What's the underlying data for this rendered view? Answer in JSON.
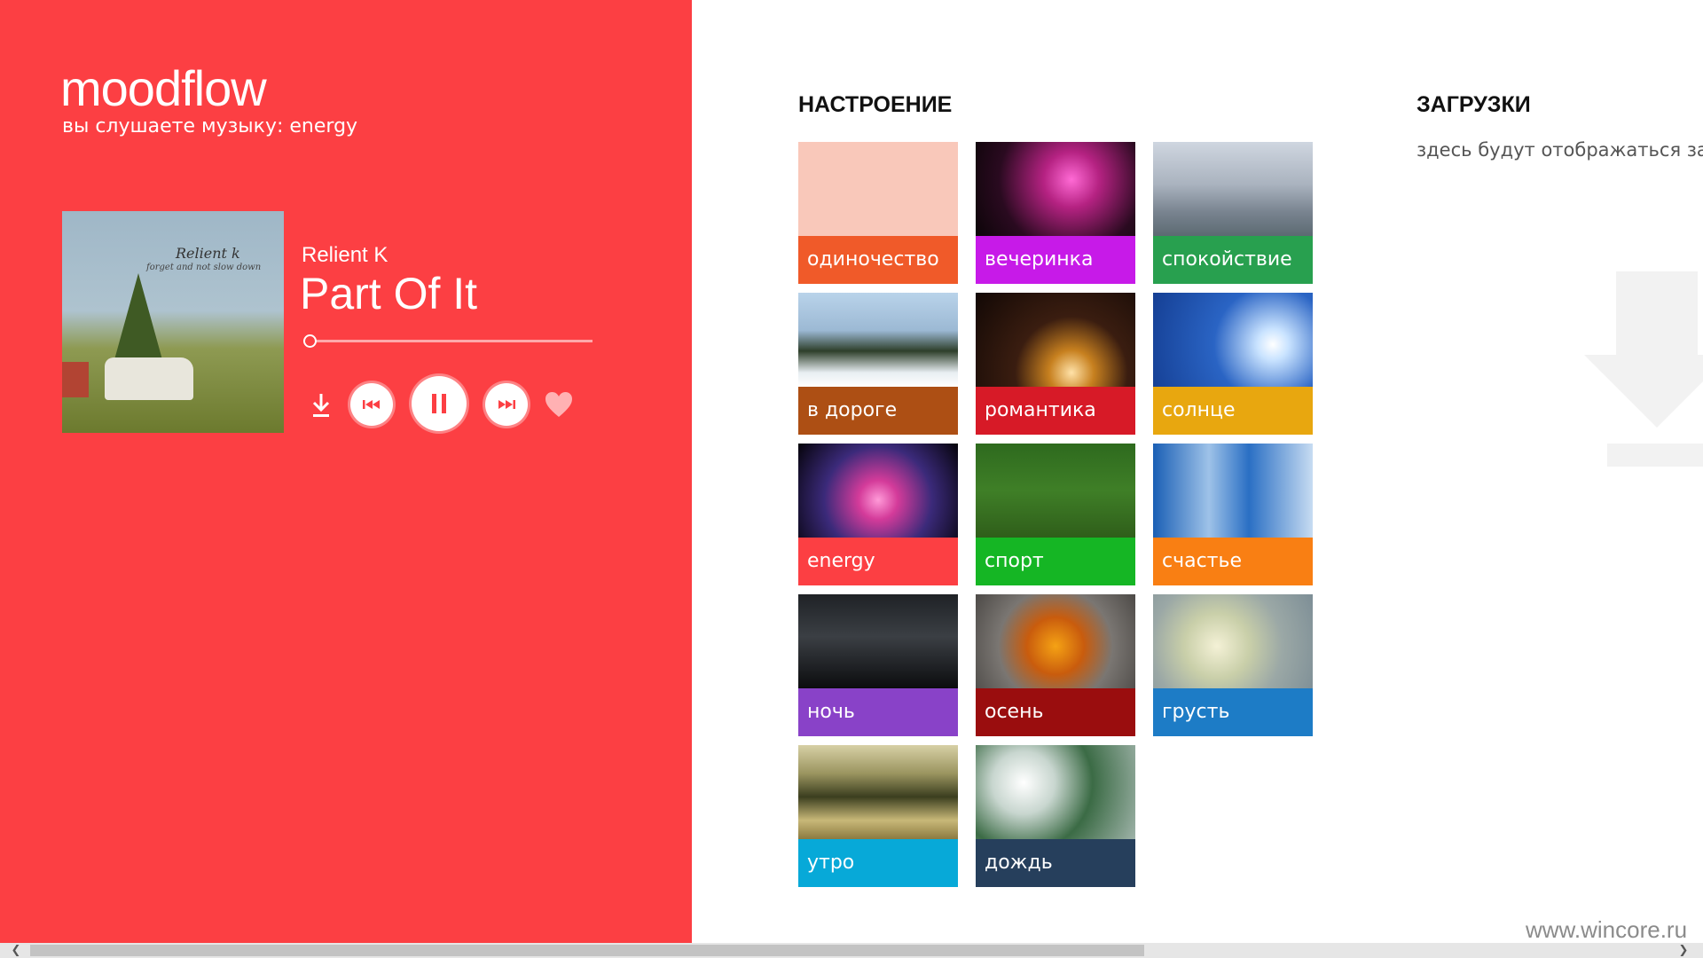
{
  "app": {
    "logo": "moodflow",
    "now_playing_caption": "вы слушаете музыку: energy"
  },
  "player": {
    "artist": "Relient K",
    "title": "Part Of It",
    "cover_text": [
      "Relient k",
      "forget and not slow down"
    ],
    "progress_fraction": 0.02,
    "controls": [
      "download-icon",
      "previous-icon",
      "pause-icon",
      "next-icon",
      "heart-icon"
    ]
  },
  "colors": {
    "accent": "#fc3f43",
    "background": "#ffffff"
  },
  "moods": {
    "heading": "НАСТРОЕНИЕ",
    "tiles": [
      {
        "label": "одиночество",
        "color": "#f05a29",
        "photo": "peach"
      },
      {
        "label": "вечеринка",
        "color": "#c71ae8",
        "photo": "fireworks"
      },
      {
        "label": "спокойствие",
        "color": "#28a04f",
        "photo": "clouds"
      },
      {
        "label": "в дороге",
        "color": "#ad4f14",
        "photo": "mountain"
      },
      {
        "label": "романтика",
        "color": "#d71a27",
        "photo": "candle"
      },
      {
        "label": "солнце",
        "color": "#e8a70f",
        "photo": "sky"
      },
      {
        "label": "energy",
        "color": "#fc3f43",
        "photo": "plasma"
      },
      {
        "label": "спорт",
        "color": "#15b624",
        "photo": "grass"
      },
      {
        "label": "счастье",
        "color": "#f97f13",
        "photo": "sign"
      },
      {
        "label": "ночь",
        "color": "#8942c8",
        "photo": "city"
      },
      {
        "label": "осень",
        "color": "#9a0d0e",
        "photo": "leaf"
      },
      {
        "label": "грусть",
        "color": "#1d7cc6",
        "photo": "flower"
      },
      {
        "label": "утро",
        "color": "#07a9d8",
        "photo": "lake"
      },
      {
        "label": "дождь",
        "color": "#263f5c",
        "photo": "rain"
      }
    ]
  },
  "downloads": {
    "heading": "ЗАГРУЗКИ",
    "empty_text": "здесь будут отображаться заг"
  },
  "watermark": "www.wincore.ru"
}
